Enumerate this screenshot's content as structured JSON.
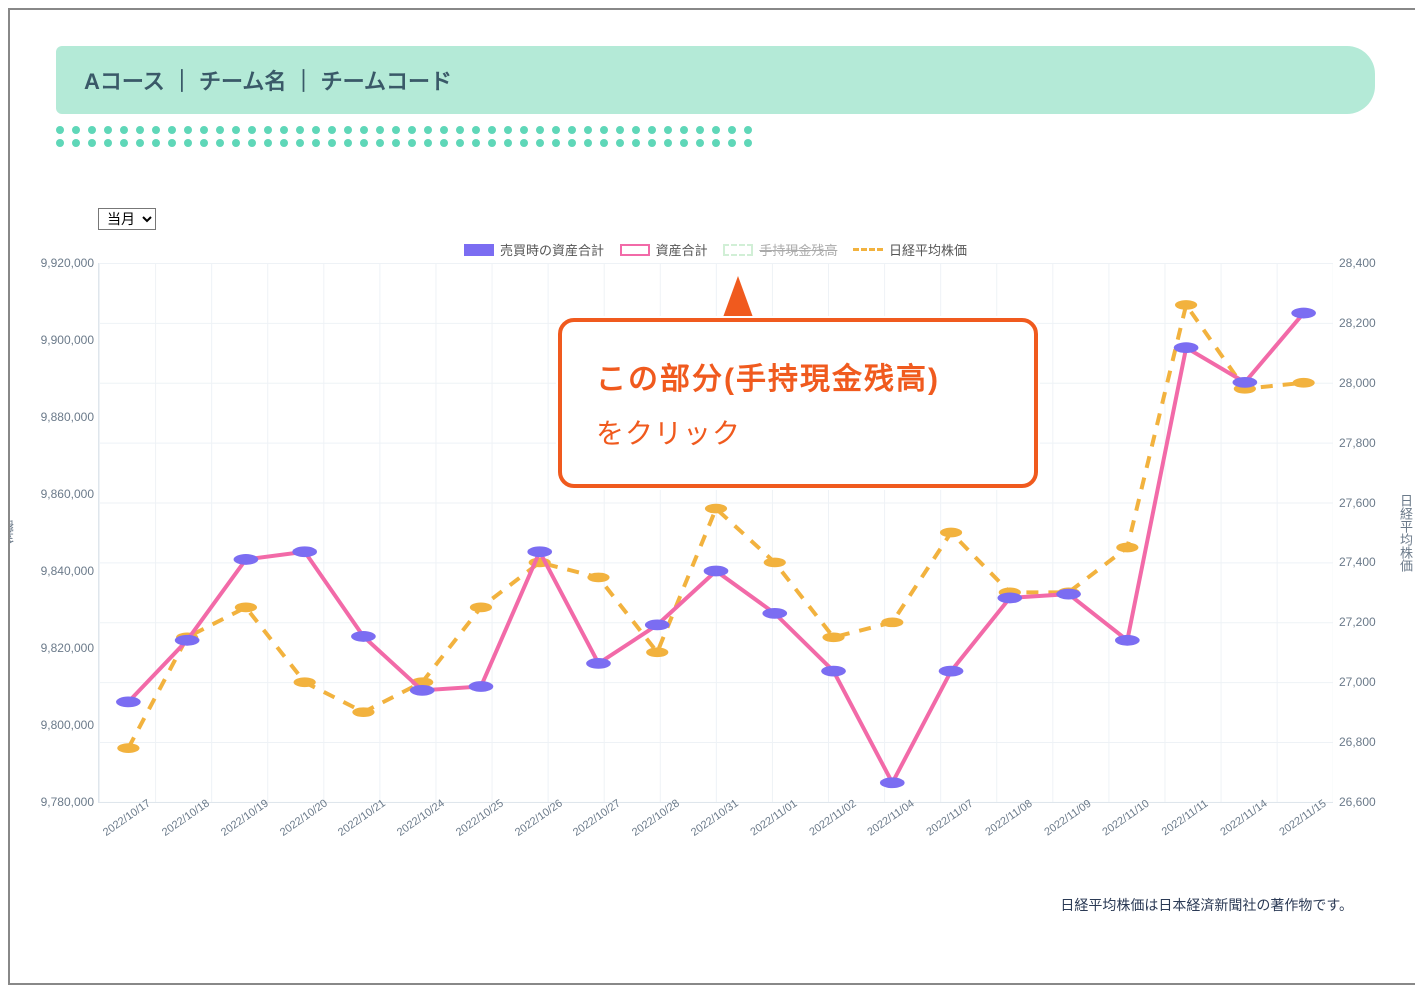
{
  "header": {
    "course": "Aコース",
    "team": "チーム名",
    "code": "チームコード"
  },
  "period_select": {
    "selected": "当月",
    "options": [
      "当月"
    ]
  },
  "legend": {
    "s1": "売買時の資産合計",
    "s2": "資産合計",
    "s3": "手持現金残高",
    "s4": "日経平均株価"
  },
  "axes": {
    "y_label": "金額",
    "y2_label": "日経平均株価",
    "y_min": 9780000,
    "y_max": 9920000,
    "y_ticks": [
      9780000,
      9800000,
      9820000,
      9840000,
      9860000,
      9880000,
      9900000,
      9920000
    ],
    "y2_min": 26600,
    "y2_max": 28400,
    "y2_ticks": [
      26600,
      26800,
      27000,
      27200,
      27400,
      27600,
      27800,
      28000,
      28200,
      28400
    ]
  },
  "footer": "日経平均株価は日本経済新聞社の著作物です。",
  "callout": {
    "line1": "この部分(手持現金残高)",
    "line2": "をクリック"
  },
  "chart_data": {
    "type": "line",
    "title": "",
    "xlabel": "",
    "ylabel": "金額",
    "y2label": "日経平均株価",
    "ylim": [
      9780000,
      9920000
    ],
    "y2lim": [
      26600,
      28400
    ],
    "categories": [
      "2022/10/17",
      "2022/10/18",
      "2022/10/19",
      "2022/10/20",
      "2022/10/21",
      "2022/10/24",
      "2022/10/25",
      "2022/10/26",
      "2022/10/27",
      "2022/10/28",
      "2022/10/31",
      "2022/11/01",
      "2022/11/02",
      "2022/11/04",
      "2022/11/07",
      "2022/11/08",
      "2022/11/09",
      "2022/11/10",
      "2022/11/11",
      "2022/11/14",
      "2022/11/15"
    ],
    "series": [
      {
        "name": "売買時の資産合計",
        "axis": "y",
        "style": "purple-dot",
        "values": [
          9806000,
          9822000,
          9843000,
          9845000,
          9823000,
          9809000,
          9810000,
          9845000,
          9816000,
          9826000,
          9840000,
          9829000,
          9814000,
          9785000,
          9814000,
          9833000,
          9834000,
          9822000,
          9898000,
          9889000,
          9907000
        ]
      },
      {
        "name": "資産合計",
        "axis": "y",
        "style": "pink-line",
        "values": [
          9806000,
          9822000,
          9843000,
          9845000,
          9823000,
          9809000,
          9810000,
          9845000,
          9816000,
          9826000,
          9840000,
          9829000,
          9814000,
          9785000,
          9814000,
          9833000,
          9834000,
          9822000,
          9898000,
          9889000,
          9907000
        ]
      },
      {
        "name": "日経平均株価",
        "axis": "y2",
        "style": "orange-dash",
        "values": [
          26780,
          27150,
          27250,
          27000,
          26900,
          27000,
          27250,
          27400,
          27350,
          27100,
          27580,
          27400,
          27150,
          27200,
          27500,
          27300,
          27300,
          27450,
          28260,
          27980,
          28000
        ]
      }
    ]
  },
  "colors": {
    "purple": "#7b6df2",
    "pink": "#f26aa8",
    "orange": "#f2b23e",
    "green": "#9bdca5",
    "accent": "#f05a1e"
  }
}
